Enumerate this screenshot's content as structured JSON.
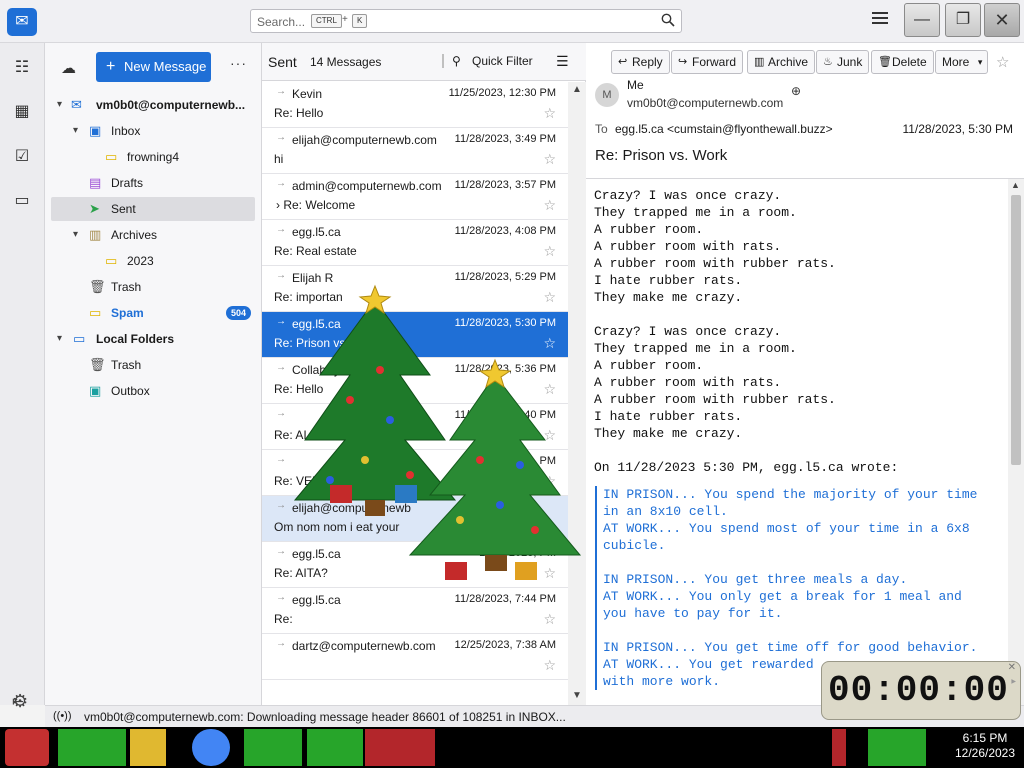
{
  "titlebar": {
    "search_placeholder": "Search...",
    "kbd_ctrl": "CTRL",
    "kbd_plus": "+",
    "kbd_k": "K"
  },
  "folders": {
    "new_message": "New Message",
    "account": "vm0b0t@computernewb...",
    "items": [
      {
        "label": "Inbox"
      },
      {
        "label": "frowning4"
      },
      {
        "label": "Drafts"
      },
      {
        "label": "Sent"
      },
      {
        "label": "Archives"
      },
      {
        "label": "2023"
      },
      {
        "label": "Trash"
      },
      {
        "label": "Spam",
        "count": "504"
      },
      {
        "label": "Local Folders"
      },
      {
        "label": "Trash"
      },
      {
        "label": "Outbox"
      }
    ]
  },
  "list": {
    "folder_name": "Sent",
    "count": "14 Messages",
    "quick_filter": "Quick Filter",
    "messages": [
      {
        "who": "Kevin",
        "date": "11/25/2023, 12:30 PM",
        "subject": "Re: Hello"
      },
      {
        "who": "elijah@computernewb.com",
        "date": "11/28/2023, 3:49 PM",
        "subject": "hi"
      },
      {
        "who": "admin@computernewb.com",
        "date": "11/28/2023, 3:57 PM",
        "subject": "Re: Welcome"
      },
      {
        "who": "egg.l5.ca",
        "date": "11/28/2023, 4:08 PM",
        "subject": "Re: Real estate"
      },
      {
        "who": "Elijah R",
        "date": "11/28/2023, 5:29 PM",
        "subject": "Re: importan"
      },
      {
        "who": "egg.l5.ca",
        "date": "11/28/2023, 5:30 PM",
        "subject": "Re: Prison vs."
      },
      {
        "who": "CollabSy",
        "date": "11/28/2023, 5:36 PM",
        "subject": "Re: Hello"
      },
      {
        "who": "",
        "date": "11/28/2023, 5:40 PM",
        "subject": "Re: AI"
      },
      {
        "who": "",
        "date": "PM",
        "subject": "Re: VERY IMPOR"
      },
      {
        "who": "elijah@computernewb",
        "date": "",
        "subject": "Om nom nom i eat your"
      },
      {
        "who": "egg.l5.ca",
        "date": "11/28/2023, PM",
        "subject": "Re: AITA?"
      },
      {
        "who": "egg.l5.ca",
        "date": "11/28/2023, 7:44 PM",
        "subject": "Re:"
      },
      {
        "who": "dartz@computernewb.com",
        "date": "12/25/2023, 7:38 AM",
        "subject": ""
      }
    ]
  },
  "reader": {
    "buttons": {
      "reply": "Reply",
      "forward": "Forward",
      "archive": "Archive",
      "junk": "Junk",
      "delete": "Delete",
      "more": "More"
    },
    "avatar_letter": "M",
    "from_name": "Me",
    "from_addr": "vm0b0t@computernewb.com",
    "to_label": "To",
    "to_addr": "egg.l5.ca <cumstain@flyonthewall.buzz>",
    "date": "11/28/2023, 5:30 PM",
    "subject": "Re: Prison vs. Work",
    "body": "Crazy? I was once crazy.\nThey trapped me in a room.\nA rubber room.\nA rubber room with rats.\nA rubber room with rubber rats.\nI hate rubber rats.\nThey make me crazy.\n\nCrazy? I was once crazy.\nThey trapped me in a room.\nA rubber room.\nA rubber room with rats.\nA rubber room with rubber rats.\nI hate rubber rats.\nThey make me crazy.\n\nOn 11/28/2023 5:30 PM, egg.l5.ca wrote:",
    "quote": "IN PRISON... You spend the majority of your time\nin an 8x10 cell.\nAT WORK... You spend most of your time in a 6x8\ncubicle.\n\nIN PRISON... You get three meals a day.\nAT WORK... You only get a break for 1 meal and\nyou have to pay for it.\n\nIN PRISON... You get time off for good behavior.\nAT WORK... You get rewarded\nwith more work."
  },
  "status": {
    "text": "vm0b0t@computernewb.com: Downloading message header 86601 of 108251 in INBOX..."
  },
  "timer": {
    "digits": "00:00:00"
  },
  "taskbar": {
    "time": "6:15 PM",
    "date": "12/26/2023"
  },
  "colors": {
    "accent": "#1f6fd6",
    "taskbar": "#000000",
    "taskbar_green": "#27a52a",
    "taskbar_red": "#b3262b"
  }
}
